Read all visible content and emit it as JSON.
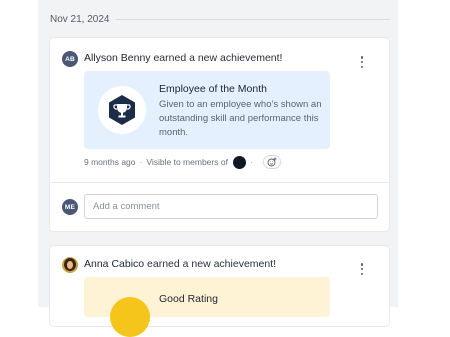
{
  "feed": {
    "date": "Nov 21, 2024",
    "posts": [
      {
        "avatar_initials": "AB",
        "name": "Allyson Benny",
        "action": " earned a new achievement!",
        "achievement_title": "Employee of the Month",
        "achievement_description": "Given to an employee who’s shown an outstanding skill and performance this month.",
        "time": "9 months ago",
        "visibility": "Visible to members of",
        "comment_avatar_initials": "ME",
        "comment_placeholder": "Add a comment"
      },
      {
        "name": "Anna Cabico",
        "action": " earned a new achievement!",
        "achievement_title": "Good Rating"
      }
    ]
  },
  "icons": {
    "trophy": "trophy-icon",
    "menu": "more-vertical-icon",
    "reaction": "add-reaction-icon"
  },
  "colors": {
    "avatar": "#4a5876",
    "achievement_bg_blue": "#e5f0ff",
    "achievement_bg_yellow": "#fff3d6",
    "badge_hex": "#1b2b4a",
    "good_rating_badge": "#f6c51b"
  }
}
